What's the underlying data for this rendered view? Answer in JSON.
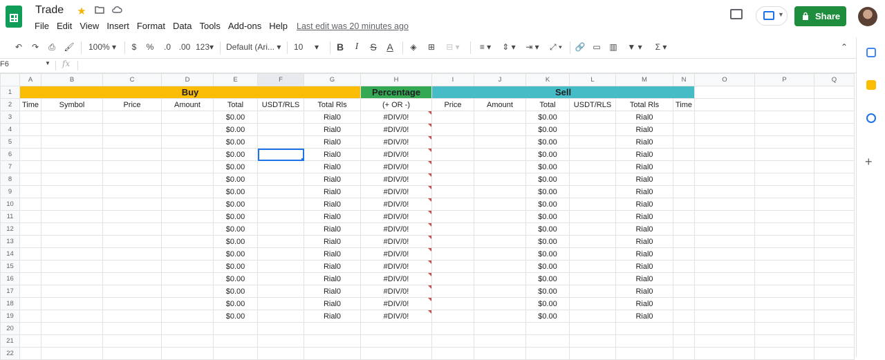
{
  "app": {
    "title": "Trade",
    "last_edit": "Last edit was 20 minutes ago",
    "share_label": "Share"
  },
  "menu": [
    "File",
    "Edit",
    "View",
    "Insert",
    "Format",
    "Data",
    "Tools",
    "Add-ons",
    "Help"
  ],
  "toolbar": {
    "zoom": "100%",
    "currency": "$",
    "percent": "%",
    "dec_decrease": ".0",
    "dec_increase": ".00",
    "more_formats": "123",
    "font": "Default (Ari...",
    "font_size": "10",
    "bold": "B",
    "italic": "I",
    "strike": "S",
    "text_color": "A"
  },
  "formula_bar": {
    "name_box": "F6",
    "fx": "fx",
    "value": ""
  },
  "columns": [
    "A",
    "B",
    "C",
    "D",
    "E",
    "F",
    "G",
    "H",
    "I",
    "J",
    "K",
    "L",
    "M",
    "N",
    "O",
    "P",
    "Q"
  ],
  "section_headers": {
    "buy": "Buy",
    "percentage": "Percentage",
    "sell": "Sell"
  },
  "subheaders": [
    "Time",
    "Symbol",
    "Price",
    "Amount",
    "Total",
    "USDT/RLS",
    "Total Rls",
    "(+ OR -)",
    "Price",
    "Amount",
    "Total",
    "USDT/RLS",
    "Total Rls",
    "Time"
  ],
  "row_numbers": [
    "1",
    "2",
    "3",
    "4",
    "5",
    "6",
    "7",
    "8",
    "9",
    "10",
    "11",
    "12",
    "13",
    "14",
    "15",
    "16",
    "17",
    "18",
    "19",
    "20",
    "21",
    "22"
  ],
  "data_rows": [
    {
      "buy_total": "$0.00",
      "buy_total_rls": "Rial0",
      "percentage": "#DIV/0!",
      "sell_total": "$0.00",
      "sell_total_rls": "Rial0"
    },
    {
      "buy_total": "$0.00",
      "buy_total_rls": "Rial0",
      "percentage": "#DIV/0!",
      "sell_total": "$0.00",
      "sell_total_rls": "Rial0"
    },
    {
      "buy_total": "$0.00",
      "buy_total_rls": "Rial0",
      "percentage": "#DIV/0!",
      "sell_total": "$0.00",
      "sell_total_rls": "Rial0"
    },
    {
      "buy_total": "$0.00",
      "buy_total_rls": "Rial0",
      "percentage": "#DIV/0!",
      "sell_total": "$0.00",
      "sell_total_rls": "Rial0"
    },
    {
      "buy_total": "$0.00",
      "buy_total_rls": "Rial0",
      "percentage": "#DIV/0!",
      "sell_total": "$0.00",
      "sell_total_rls": "Rial0"
    },
    {
      "buy_total": "$0.00",
      "buy_total_rls": "Rial0",
      "percentage": "#DIV/0!",
      "sell_total": "$0.00",
      "sell_total_rls": "Rial0"
    },
    {
      "buy_total": "$0.00",
      "buy_total_rls": "Rial0",
      "percentage": "#DIV/0!",
      "sell_total": "$0.00",
      "sell_total_rls": "Rial0"
    },
    {
      "buy_total": "$0.00",
      "buy_total_rls": "Rial0",
      "percentage": "#DIV/0!",
      "sell_total": "$0.00",
      "sell_total_rls": "Rial0"
    },
    {
      "buy_total": "$0.00",
      "buy_total_rls": "Rial0",
      "percentage": "#DIV/0!",
      "sell_total": "$0.00",
      "sell_total_rls": "Rial0"
    },
    {
      "buy_total": "$0.00",
      "buy_total_rls": "Rial0",
      "percentage": "#DIV/0!",
      "sell_total": "$0.00",
      "sell_total_rls": "Rial0"
    },
    {
      "buy_total": "$0.00",
      "buy_total_rls": "Rial0",
      "percentage": "#DIV/0!",
      "sell_total": "$0.00",
      "sell_total_rls": "Rial0"
    },
    {
      "buy_total": "$0.00",
      "buy_total_rls": "Rial0",
      "percentage": "#DIV/0!",
      "sell_total": "$0.00",
      "sell_total_rls": "Rial0"
    },
    {
      "buy_total": "$0.00",
      "buy_total_rls": "Rial0",
      "percentage": "#DIV/0!",
      "sell_total": "$0.00",
      "sell_total_rls": "Rial0"
    },
    {
      "buy_total": "$0.00",
      "buy_total_rls": "Rial0",
      "percentage": "#DIV/0!",
      "sell_total": "$0.00",
      "sell_total_rls": "Rial0"
    },
    {
      "buy_total": "$0.00",
      "buy_total_rls": "Rial0",
      "percentage": "#DIV/0!",
      "sell_total": "$0.00",
      "sell_total_rls": "Rial0"
    },
    {
      "buy_total": "$0.00",
      "buy_total_rls": "Rial0",
      "percentage": "#DIV/0!",
      "sell_total": "$0.00",
      "sell_total_rls": "Rial0"
    },
    {
      "buy_total": "$0.00",
      "buy_total_rls": "Rial0",
      "percentage": "#DIV/0!",
      "sell_total": "$0.00",
      "sell_total_rls": "Rial0"
    }
  ],
  "colors": {
    "buy": "#fbbc04",
    "percentage": "#34a853",
    "sell": "#46bdc6",
    "share": "#1e8e3e",
    "selection": "#1a73e8"
  }
}
